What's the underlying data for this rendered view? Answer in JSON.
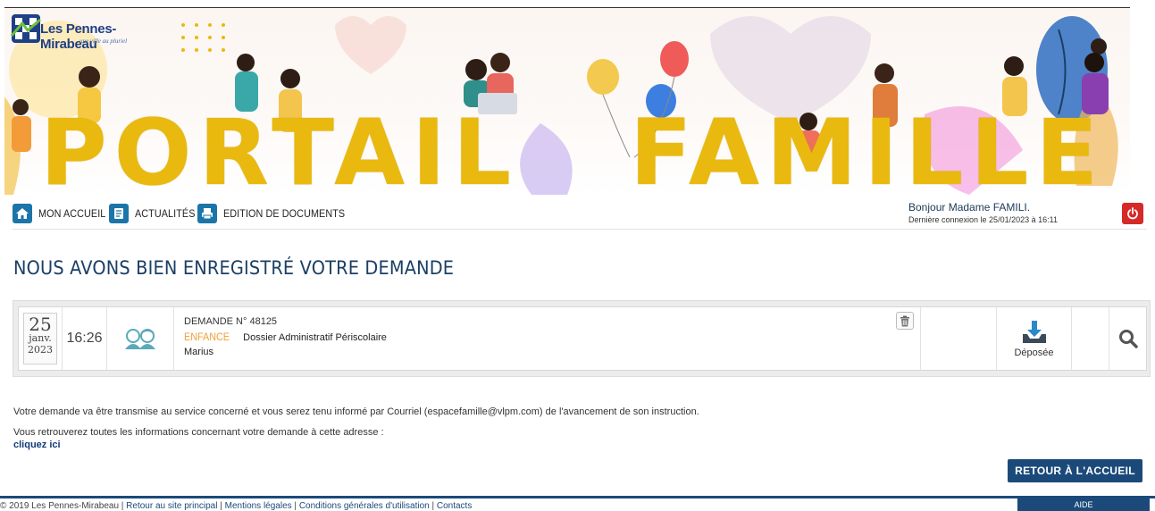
{
  "branding": {
    "logo_name": "Les Pennes-Mirabeau",
    "logo_tagline": "une ville au pluriel",
    "banner_word1": "PORTAIL",
    "banner_word2": "FAMILLE",
    "colors": {
      "banner_yellow": "#e9b90f",
      "primary_blue": "#1b4a7a",
      "nav_icon_blue": "#1b75a8",
      "danger_red": "#d52a28",
      "category_orange": "#f1a13a"
    }
  },
  "nav": {
    "items": [
      {
        "label": "MON ACCUEIL",
        "icon": "home-icon"
      },
      {
        "label": "ACTUALITÉS",
        "icon": "news-icon"
      },
      {
        "label": "EDITION DE DOCUMENTS",
        "icon": "print-icon"
      }
    ],
    "greeting": "Bonjour Madame FAMILI.",
    "last_login": "Dernière connexion le 25/01/2023 à 16:11",
    "logout_icon": "power-icon"
  },
  "page": {
    "title": "NOUS AVONS BIEN ENREGISTRÉ VOTRE DEMANDE"
  },
  "request": {
    "date_day": "25",
    "date_month": "janv.",
    "date_year": "2023",
    "time": "16:26",
    "number": "DEMANDE N° 48125",
    "category": "ENFANCE",
    "description": "Dossier Administratif Périscolaire",
    "child": "Marius",
    "status": "Déposée"
  },
  "messages": {
    "line1": "Votre demande va être transmise au service concerné et vous serez tenu informé par Courriel (espacefamille@vlpm.com) de l'avancement de son instruction.",
    "line2": "Vous retrouverez toutes les informations concernant votre demande à cette adresse :",
    "link": "cliquez ici"
  },
  "actions": {
    "back_home": "RETOUR À L'ACCUEIL"
  },
  "footer": {
    "copyright": "© 2019 Les Pennes-Mirabeau | ",
    "links": [
      "Retour au site principal",
      "Mentions légales",
      "Conditions générales d'utilisation",
      "Contacts"
    ],
    "help": "AIDE"
  }
}
